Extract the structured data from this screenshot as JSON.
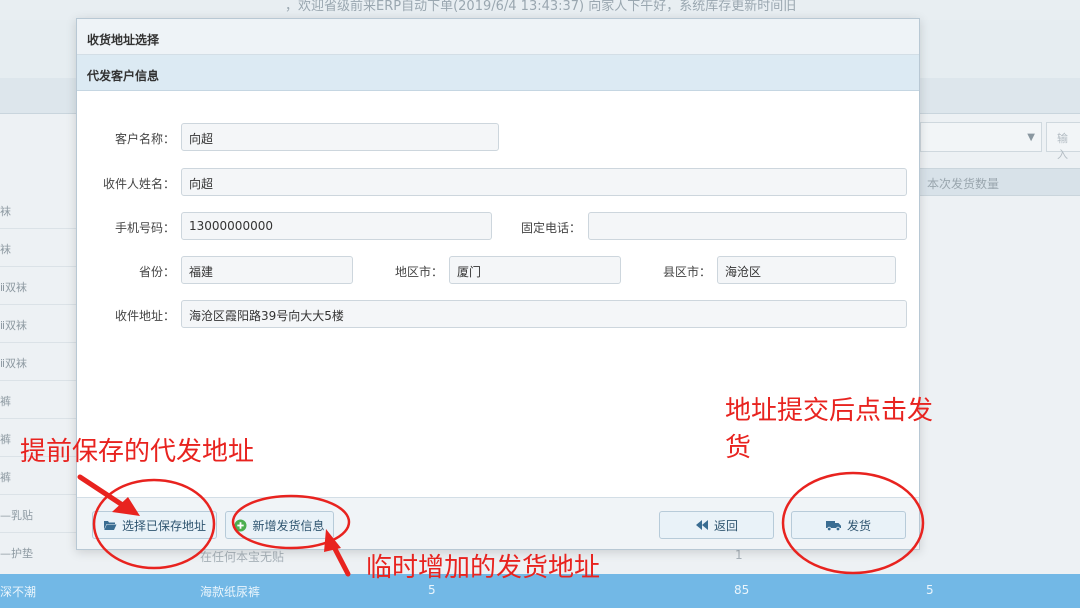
{
  "background": {
    "welcome_text": "，欢迎省级前来ERP自动下单(2019/6/4 13:43:37) 向家人下午好，系统库存更新时间旧",
    "column_header": "本次发货数量",
    "input_placeholder": "输入",
    "row_labels": [
      "袜",
      "袜",
      "ⅱ双袜",
      "ⅱ双袜",
      "ⅱ双袜",
      "裤",
      "裤",
      "裤",
      "—乳贴",
      "—护垫"
    ],
    "mid_text": "在任何本宝无贴",
    "mid_number": "1",
    "selected_row": {
      "col1": "深不潮",
      "col2": "海款纸尿裤",
      "col3": "5",
      "col4": "85",
      "col5": "5"
    }
  },
  "modal": {
    "title": "收货地址选择",
    "section_title": "代发客户信息",
    "form": {
      "customer_name_label": "客户名称：",
      "customer_name_value": "向超",
      "receiver_name_label": "收件人姓名：",
      "receiver_name_value": "向超",
      "mobile_label": "手机号码：",
      "mobile_value": "13000000000",
      "phone_label": "固定电话：",
      "phone_value": "",
      "province_label": "省份：",
      "province_value": "福建",
      "city_label": "地区市：",
      "city_value": "厦门",
      "county_label": "县区市：",
      "county_value": "海沧区",
      "address_label": "收件地址：",
      "address_value": "海沧区霞阳路39号向大大5楼"
    },
    "footer": {
      "choose_saved_label": "选择已保存地址",
      "add_new_label": "新增发货信息",
      "back_label": "返回",
      "ship_label": "发货"
    }
  },
  "annotations": {
    "saved_address_note": "提前保存的代发地址",
    "temp_address_note": "临时增加的发货地址",
    "ship_note_line1": "地址提交后点击发",
    "ship_note_line2": "货"
  },
  "colors": {
    "annotation_red": "#e8231f",
    "selected_row_blue": "#72b8e6",
    "section_blue": "#dceaf3"
  }
}
